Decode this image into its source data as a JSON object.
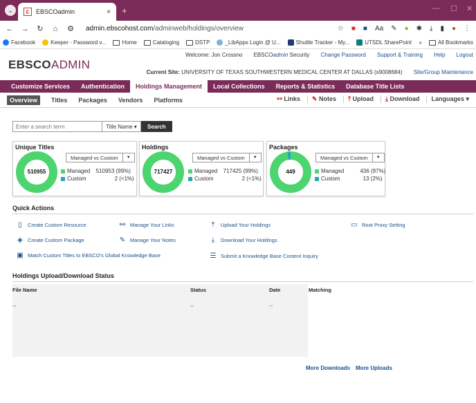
{
  "browser": {
    "tab_title": "EBSCOadmin",
    "tab_close": "×",
    "new_tab": "+",
    "window_min": "—",
    "window_max": "☐",
    "window_close": "✕",
    "url_host": "admin.ebscohost.com",
    "url_path": "/adminweb/holdings/overview",
    "bookmarks": [
      {
        "label": "Facebook",
        "color": "#1877f2"
      },
      {
        "label": "Keeper - Password v...",
        "color": "#f5c400"
      },
      {
        "label": "Home",
        "folder": true
      },
      {
        "label": "Cataloging",
        "folder": true
      },
      {
        "label": "DSTP",
        "folder": true
      },
      {
        "label": "_LibApps Login @ U...",
        "color": "#7fb3d5"
      },
      {
        "label": "Shuttle Tracker - My...",
        "color": "#1f3a6b"
      },
      {
        "label": "UTSDL SharePoint",
        "color": "#0f7b7b"
      }
    ],
    "bookmarks_more": "»",
    "all_bookmarks": "All Bookmarks"
  },
  "header": {
    "logo_bold": "EBSCO",
    "logo_light": "ADMIN",
    "welcome": "Welcome: Jon Crossno",
    "security_pre": "EBSCO",
    "security_ital": "admin",
    "security_post": " Security",
    "change_password": "Change Password",
    "support": "Support & Training",
    "help": "Help",
    "logout": "Logout",
    "current_site_label": "Current Site:",
    "current_site_value": "UNIVERSITY OF TEXAS SOUTHWESTERN MEDICAL CENTER AT DALLAS (s9008684)",
    "site_group": "Site/Group Maintenance"
  },
  "mainnav": [
    "Customize Services",
    "Authentication",
    "Holdings Management",
    "Local Collections",
    "Reports & Statistics",
    "Database Title Lists"
  ],
  "subnav": {
    "items": [
      "Overview",
      "Titles",
      "Packages",
      "Vendors",
      "Platforms"
    ],
    "links": "Links",
    "notes": "Notes",
    "upload": "Upload",
    "download": "Download",
    "languages": "Languages ▾"
  },
  "search": {
    "placeholder": "Enter a search term",
    "field": "Title Name ▾",
    "button": "Search"
  },
  "cards": [
    {
      "title": "Unique Titles",
      "select": "Managed vs Custom",
      "total": "510955",
      "managed_label": "Managed",
      "managed_value": "510953 (99%)",
      "custom_label": "Custom",
      "custom_value": "2 (<1%)"
    },
    {
      "title": "Holdings",
      "select": "Managed vs Custom",
      "total": "717427",
      "managed_label": "Managed",
      "managed_value": "717425 (99%)",
      "custom_label": "Custom",
      "custom_value": "2 (<1%)"
    },
    {
      "title": "Packages",
      "select": "Managed vs Custom",
      "total": "449",
      "managed_label": "Managed",
      "managed_value": "436 (97%)",
      "custom_label": "Custom",
      "custom_value": "13 (2%)"
    }
  ],
  "chart_data": [
    {
      "type": "pie",
      "categories": [
        "Managed",
        "Custom"
      ],
      "values": [
        510953,
        2
      ]
    },
    {
      "type": "pie",
      "categories": [
        "Managed",
        "Custom"
      ],
      "values": [
        717425,
        2
      ]
    },
    {
      "type": "pie",
      "categories": [
        "Managed",
        "Custom"
      ],
      "values": [
        436,
        13
      ]
    }
  ],
  "colors": {
    "managed": "#4cd46e",
    "custom": "#2aa7b7",
    "brand": "#7a2b58",
    "link": "#1a4f8a"
  },
  "quick_actions": {
    "title": "Quick Actions",
    "create_custom_resource": "Create Custom Resource",
    "manage_links": "Manage Your Links",
    "upload_holdings": "Upload Your Holdings",
    "root_proxy": "Root Proxy Setting",
    "create_custom_package": "Create Custom Package",
    "manage_notes": "Manage Your Notes",
    "download_holdings": "Download Your Holdings",
    "match_titles": "Match Custom Titles to EBSCO's Global Knowledge Base",
    "submit_inquiry": "Submit a Knowledge Base Content Inquiry"
  },
  "status": {
    "title": "Holdings Upload/Download Status",
    "col_file": "File Name",
    "col_status": "Status",
    "col_date": "Date",
    "col_matching": "Matching",
    "row_file": "--",
    "row_status": "--",
    "row_date": "--",
    "more_downloads": "More Downloads",
    "more_uploads": "More Uploads"
  }
}
